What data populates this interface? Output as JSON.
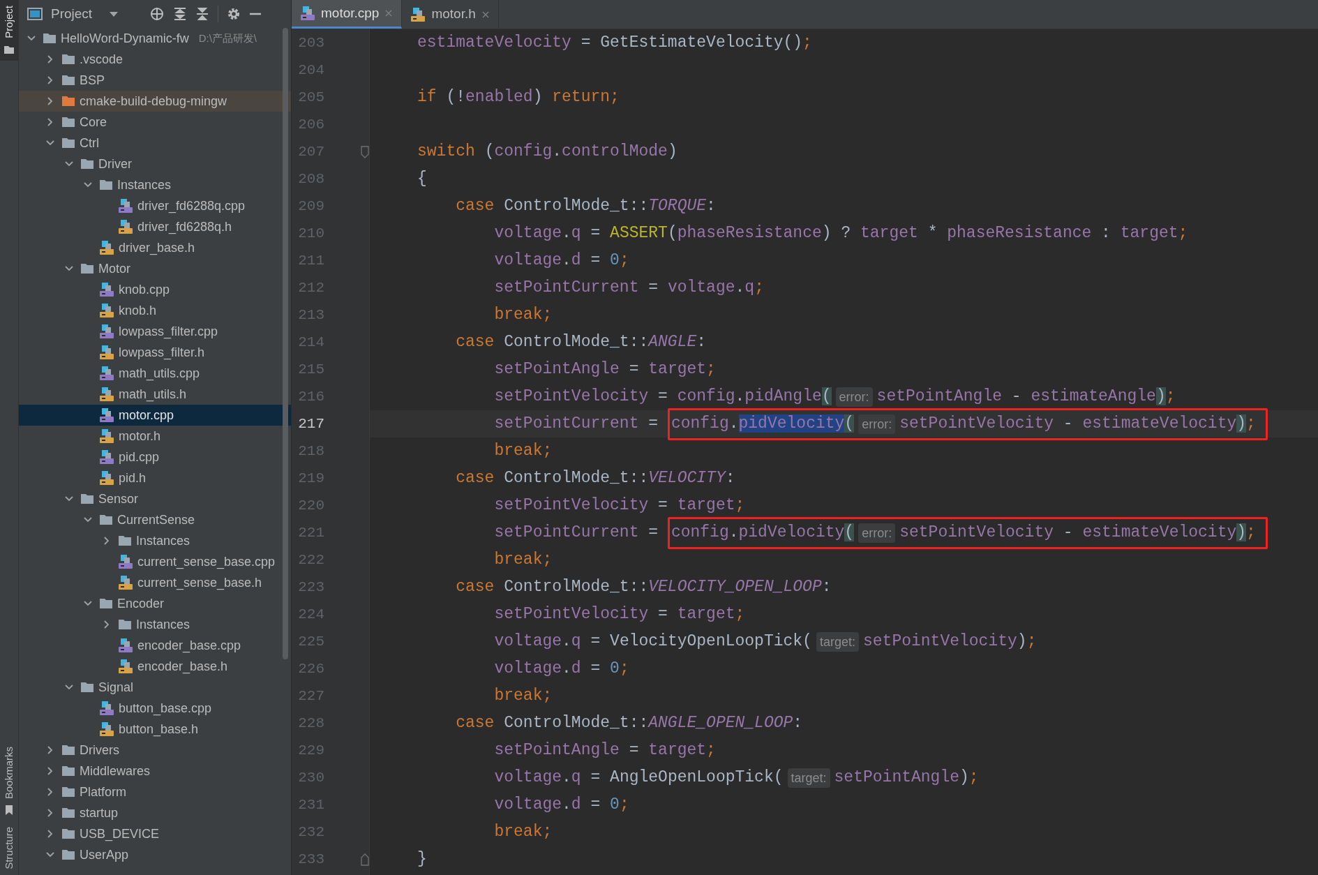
{
  "tool_strip": [
    {
      "label": "Project",
      "selected": true
    },
    {
      "label": "Bookmarks",
      "selected": false
    },
    {
      "label": "Structure",
      "selected": false
    }
  ],
  "project_panel": {
    "title": "Project",
    "tree": [
      {
        "label": "HelloWord-Dynamic-fw",
        "path": "D:\\产品研发\\",
        "kind": "folder",
        "expanded": true,
        "selected": false,
        "children": [
          {
            "label": ".vscode",
            "kind": "folder",
            "expanded": false,
            "selected": false
          },
          {
            "label": "BSP",
            "kind": "folder",
            "expanded": false,
            "selected": false
          },
          {
            "label": "cmake-build-debug-mingw",
            "kind": "excluded",
            "expanded": false,
            "selected": false
          },
          {
            "label": "Core",
            "kind": "folder",
            "expanded": false,
            "selected": false
          },
          {
            "label": "Ctrl",
            "kind": "folder",
            "expanded": true,
            "selected": false,
            "children": [
              {
                "label": "Driver",
                "kind": "folder",
                "expanded": true,
                "selected": false,
                "children": [
                  {
                    "label": "Instances",
                    "kind": "folder",
                    "expanded": true,
                    "selected": false,
                    "children": [
                      {
                        "label": "driver_fd6288q.cpp",
                        "kind": "cpp",
                        "selected": false
                      },
                      {
                        "label": "driver_fd6288q.h",
                        "kind": "h",
                        "selected": false
                      }
                    ]
                  },
                  {
                    "label": "driver_base.h",
                    "kind": "h",
                    "selected": false
                  }
                ]
              },
              {
                "label": "Motor",
                "kind": "folder",
                "expanded": true,
                "selected": false,
                "children": [
                  {
                    "label": "knob.cpp",
                    "kind": "cpp",
                    "selected": false
                  },
                  {
                    "label": "knob.h",
                    "kind": "h",
                    "selected": false
                  },
                  {
                    "label": "lowpass_filter.cpp",
                    "kind": "cpp",
                    "selected": false
                  },
                  {
                    "label": "lowpass_filter.h",
                    "kind": "h",
                    "selected": false
                  },
                  {
                    "label": "math_utils.cpp",
                    "kind": "cpp",
                    "selected": false
                  },
                  {
                    "label": "math_utils.h",
                    "kind": "h",
                    "selected": false
                  },
                  {
                    "label": "motor.cpp",
                    "kind": "cpp",
                    "selected": true
                  },
                  {
                    "label": "motor.h",
                    "kind": "h",
                    "selected": false
                  },
                  {
                    "label": "pid.cpp",
                    "kind": "cpp",
                    "selected": false
                  },
                  {
                    "label": "pid.h",
                    "kind": "h",
                    "selected": false
                  }
                ]
              },
              {
                "label": "Sensor",
                "kind": "folder",
                "expanded": true,
                "selected": false,
                "children": [
                  {
                    "label": "CurrentSense",
                    "kind": "folder",
                    "expanded": true,
                    "selected": false,
                    "children": [
                      {
                        "label": "Instances",
                        "kind": "folder",
                        "expanded": false,
                        "selected": false
                      },
                      {
                        "label": "current_sense_base.cpp",
                        "kind": "cpp",
                        "selected": false
                      },
                      {
                        "label": "current_sense_base.h",
                        "kind": "h",
                        "selected": false
                      }
                    ]
                  },
                  {
                    "label": "Encoder",
                    "kind": "folder",
                    "expanded": true,
                    "selected": false,
                    "children": [
                      {
                        "label": "Instances",
                        "kind": "folder",
                        "expanded": false,
                        "selected": false
                      },
                      {
                        "label": "encoder_base.cpp",
                        "kind": "cpp",
                        "selected": false
                      },
                      {
                        "label": "encoder_base.h",
                        "kind": "h",
                        "selected": false
                      }
                    ]
                  }
                ]
              },
              {
                "label": "Signal",
                "kind": "folder",
                "expanded": true,
                "selected": false,
                "children": [
                  {
                    "label": "button_base.cpp",
                    "kind": "cpp",
                    "selected": false
                  },
                  {
                    "label": "button_base.h",
                    "kind": "h",
                    "selected": false
                  }
                ]
              }
            ]
          },
          {
            "label": "Drivers",
            "kind": "folder",
            "expanded": false,
            "selected": false
          },
          {
            "label": "Middlewares",
            "kind": "folder",
            "expanded": false,
            "selected": false
          },
          {
            "label": "Platform",
            "kind": "folder",
            "expanded": false,
            "selected": false
          },
          {
            "label": "startup",
            "kind": "folder",
            "expanded": false,
            "selected": false
          },
          {
            "label": "USB_DEVICE",
            "kind": "folder",
            "expanded": false,
            "selected": false
          },
          {
            "label": "UserApp",
            "kind": "folder",
            "expanded": true,
            "selected": false
          }
        ]
      }
    ]
  },
  "tabs": [
    {
      "label": "motor.cpp",
      "kind": "cpp",
      "selected": true
    },
    {
      "label": "motor.h",
      "kind": "h",
      "selected": false
    }
  ],
  "editor": {
    "lines": [
      {
        "number": "203",
        "current": false,
        "tokens": [
          {
            "kind": "field",
            "text": "estimateVelocity"
          },
          {
            "kind": "plain",
            "text": " = GetEstimateVelocity()"
          },
          {
            "kind": "keyword",
            "text": ";"
          }
        ]
      },
      {
        "number": "204",
        "current": false
      },
      {
        "number": "205",
        "current": false,
        "tokens": [
          {
            "kind": "keyword",
            "text": "if"
          },
          {
            "kind": "plain",
            "text": " (!"
          },
          {
            "kind": "field",
            "text": "enabled"
          },
          {
            "kind": "plain",
            "text": ") "
          },
          {
            "kind": "keyword",
            "text": "return;"
          }
        ]
      },
      {
        "number": "206",
        "current": false
      },
      {
        "number": "207",
        "current": false,
        "fold_start": true,
        "tokens": [
          {
            "kind": "keyword",
            "text": "switch"
          },
          {
            "kind": "plain",
            "text": " ("
          },
          {
            "kind": "field",
            "text": "config"
          },
          {
            "kind": "plain",
            "text": "."
          },
          {
            "kind": "field",
            "text": "controlMode"
          },
          {
            "kind": "plain",
            "text": ")"
          }
        ]
      },
      {
        "number": "208",
        "current": false,
        "tokens": [
          {
            "kind": "plain",
            "text": "{"
          }
        ]
      },
      {
        "number": "209",
        "current": false,
        "tokens": [
          {
            "kind": "keyword",
            "text": "    case"
          },
          {
            "kind": "plain",
            "text": " ControlMode_t::"
          },
          {
            "kind": "enum",
            "text": "TORQUE"
          },
          {
            "kind": "plain",
            "text": ":"
          }
        ]
      },
      {
        "number": "210",
        "current": false,
        "tokens": [
          {
            "kind": "field",
            "text": "        voltage"
          },
          {
            "kind": "plain",
            "text": "."
          },
          {
            "kind": "field",
            "text": "q"
          },
          {
            "kind": "plain",
            "text": " = "
          },
          {
            "kind": "macro",
            "text": "ASSERT"
          },
          {
            "kind": "plain",
            "text": "("
          },
          {
            "kind": "field",
            "text": "phaseResistance"
          },
          {
            "kind": "plain",
            "text": ") ? "
          },
          {
            "kind": "field",
            "text": "target"
          },
          {
            "kind": "plain",
            "text": " * "
          },
          {
            "kind": "field",
            "text": "phaseResistance"
          },
          {
            "kind": "plain",
            "text": " : "
          },
          {
            "kind": "field",
            "text": "target"
          },
          {
            "kind": "keyword",
            "text": ";"
          }
        ]
      },
      {
        "number": "211",
        "current": false,
        "tokens": [
          {
            "kind": "field",
            "text": "        voltage"
          },
          {
            "kind": "plain",
            "text": "."
          },
          {
            "kind": "field",
            "text": "d"
          },
          {
            "kind": "plain",
            "text": " = "
          },
          {
            "kind": "number",
            "text": "0"
          },
          {
            "kind": "keyword",
            "text": ";"
          }
        ]
      },
      {
        "number": "212",
        "current": false,
        "tokens": [
          {
            "kind": "field",
            "text": "        setPointCurrent"
          },
          {
            "kind": "plain",
            "text": " = "
          },
          {
            "kind": "field",
            "text": "voltage"
          },
          {
            "kind": "plain",
            "text": "."
          },
          {
            "kind": "field",
            "text": "q"
          },
          {
            "kind": "keyword",
            "text": ";"
          }
        ]
      },
      {
        "number": "213",
        "current": false,
        "tokens": [
          {
            "kind": "keyword",
            "text": "        break;"
          }
        ]
      },
      {
        "number": "214",
        "current": false,
        "tokens": [
          {
            "kind": "keyword",
            "text": "    case"
          },
          {
            "kind": "plain",
            "text": " ControlMode_t::"
          },
          {
            "kind": "enum",
            "text": "ANGLE"
          },
          {
            "kind": "plain",
            "text": ":"
          }
        ]
      },
      {
        "number": "215",
        "current": false,
        "tokens": [
          {
            "kind": "field",
            "text": "        setPointAngle"
          },
          {
            "kind": "plain",
            "text": " = "
          },
          {
            "kind": "field",
            "text": "target"
          },
          {
            "kind": "keyword",
            "text": ";"
          }
        ]
      },
      {
        "number": "216",
        "current": false,
        "tokens": [
          {
            "kind": "field",
            "text": "        setPointVelocity"
          },
          {
            "kind": "plain",
            "text": " = "
          },
          {
            "kind": "field",
            "text": "config"
          },
          {
            "kind": "plain",
            "text": "."
          },
          {
            "kind": "field",
            "text": "pidAngle"
          },
          {
            "kind": "brace",
            "text": "("
          },
          {
            "kind": "hint",
            "text": "error:"
          },
          {
            "kind": "field",
            "text": "setPointAngle"
          },
          {
            "kind": "plain",
            "text": " - "
          },
          {
            "kind": "field",
            "text": "estimateAngle"
          },
          {
            "kind": "brace",
            "text": ")"
          },
          {
            "kind": "keyword",
            "text": ";"
          }
        ]
      },
      {
        "number": "217",
        "current": true,
        "tokens": [
          {
            "kind": "field",
            "text": "        setPointCurrent"
          },
          {
            "kind": "plain",
            "text": " = "
          }
        ],
        "annotated_tokens": [
          {
            "kind": "field",
            "text": "config"
          },
          {
            "kind": "plain",
            "text": "."
          },
          {
            "kind": "selection",
            "text": "pidVelocity"
          },
          {
            "kind": "brace",
            "text": "("
          },
          {
            "kind": "hint",
            "text": "error:"
          },
          {
            "kind": "field",
            "text": "setPointVelocity"
          },
          {
            "kind": "plain",
            "text": " - "
          },
          {
            "kind": "field",
            "text": "estimateVelocity"
          },
          {
            "kind": "brace",
            "text": ")"
          },
          {
            "kind": "keyword",
            "text": ";"
          }
        ]
      },
      {
        "number": "218",
        "current": false,
        "tokens": [
          {
            "kind": "keyword",
            "text": "        break;"
          }
        ]
      },
      {
        "number": "219",
        "current": false,
        "tokens": [
          {
            "kind": "keyword",
            "text": "    case"
          },
          {
            "kind": "plain",
            "text": " ControlMode_t::"
          },
          {
            "kind": "enum",
            "text": "VELOCITY"
          },
          {
            "kind": "plain",
            "text": ":"
          }
        ]
      },
      {
        "number": "220",
        "current": false,
        "tokens": [
          {
            "kind": "field",
            "text": "        setPointVelocity"
          },
          {
            "kind": "plain",
            "text": " = "
          },
          {
            "kind": "field",
            "text": "target"
          },
          {
            "kind": "keyword",
            "text": ";"
          }
        ]
      },
      {
        "number": "221",
        "current": false,
        "tokens": [
          {
            "kind": "field",
            "text": "        setPointCurrent"
          },
          {
            "kind": "plain",
            "text": " = "
          }
        ],
        "annotated_tokens": [
          {
            "kind": "field",
            "text": "config"
          },
          {
            "kind": "plain",
            "text": "."
          },
          {
            "kind": "field",
            "text": "pidVelocity"
          },
          {
            "kind": "brace",
            "text": "("
          },
          {
            "kind": "hint",
            "text": "error:"
          },
          {
            "kind": "field",
            "text": "setPointVelocity"
          },
          {
            "kind": "plain",
            "text": " - "
          },
          {
            "kind": "field",
            "text": "estimateVelocity"
          },
          {
            "kind": "brace",
            "text": ")"
          },
          {
            "kind": "keyword",
            "text": ";"
          }
        ]
      },
      {
        "number": "222",
        "current": false,
        "tokens": [
          {
            "kind": "keyword",
            "text": "        break;"
          }
        ]
      },
      {
        "number": "223",
        "current": false,
        "tokens": [
          {
            "kind": "keyword",
            "text": "    case"
          },
          {
            "kind": "plain",
            "text": " ControlMode_t::"
          },
          {
            "kind": "enum",
            "text": "VELOCITY_OPEN_LOOP"
          },
          {
            "kind": "plain",
            "text": ":"
          }
        ]
      },
      {
        "number": "224",
        "current": false,
        "tokens": [
          {
            "kind": "field",
            "text": "        setPointVelocity"
          },
          {
            "kind": "plain",
            "text": " = "
          },
          {
            "kind": "field",
            "text": "target"
          },
          {
            "kind": "keyword",
            "text": ";"
          }
        ]
      },
      {
        "number": "225",
        "current": false,
        "tokens": [
          {
            "kind": "field",
            "text": "        voltage"
          },
          {
            "kind": "plain",
            "text": "."
          },
          {
            "kind": "field",
            "text": "q"
          },
          {
            "kind": "plain",
            "text": " = VelocityOpenLoopTick("
          },
          {
            "kind": "hint",
            "text": "target:"
          },
          {
            "kind": "field",
            "text": "setPointVelocity"
          },
          {
            "kind": "plain",
            "text": ")"
          },
          {
            "kind": "keyword",
            "text": ";"
          }
        ]
      },
      {
        "number": "226",
        "current": false,
        "tokens": [
          {
            "kind": "field",
            "text": "        voltage"
          },
          {
            "kind": "plain",
            "text": "."
          },
          {
            "kind": "field",
            "text": "d"
          },
          {
            "kind": "plain",
            "text": " = "
          },
          {
            "kind": "number",
            "text": "0"
          },
          {
            "kind": "keyword",
            "text": ";"
          }
        ]
      },
      {
        "number": "227",
        "current": false,
        "tokens": [
          {
            "kind": "keyword",
            "text": "        break;"
          }
        ]
      },
      {
        "number": "228",
        "current": false,
        "tokens": [
          {
            "kind": "keyword",
            "text": "    case"
          },
          {
            "kind": "plain",
            "text": " ControlMode_t::"
          },
          {
            "kind": "enum",
            "text": "ANGLE_OPEN_LOOP"
          },
          {
            "kind": "plain",
            "text": ":"
          }
        ]
      },
      {
        "number": "229",
        "current": false,
        "tokens": [
          {
            "kind": "field",
            "text": "        setPointAngle"
          },
          {
            "kind": "plain",
            "text": " = "
          },
          {
            "kind": "field",
            "text": "target"
          },
          {
            "kind": "keyword",
            "text": ";"
          }
        ]
      },
      {
        "number": "230",
        "current": false,
        "tokens": [
          {
            "kind": "field",
            "text": "        voltage"
          },
          {
            "kind": "plain",
            "text": "."
          },
          {
            "kind": "field",
            "text": "q"
          },
          {
            "kind": "plain",
            "text": " = AngleOpenLoopTick("
          },
          {
            "kind": "hint",
            "text": "target:"
          },
          {
            "kind": "field",
            "text": "setPointAngle"
          },
          {
            "kind": "plain",
            "text": ")"
          },
          {
            "kind": "keyword",
            "text": ";"
          }
        ]
      },
      {
        "number": "231",
        "current": false,
        "tokens": [
          {
            "kind": "field",
            "text": "        voltage"
          },
          {
            "kind": "plain",
            "text": "."
          },
          {
            "kind": "field",
            "text": "d"
          },
          {
            "kind": "plain",
            "text": " = "
          },
          {
            "kind": "number",
            "text": "0"
          },
          {
            "kind": "keyword",
            "text": ";"
          }
        ]
      },
      {
        "number": "232",
        "current": false,
        "tokens": [
          {
            "kind": "keyword",
            "text": "        break;"
          }
        ]
      },
      {
        "number": "233",
        "current": false,
        "fold_end": true,
        "tokens": [
          {
            "kind": "plain",
            "text": "}"
          }
        ]
      }
    ]
  }
}
